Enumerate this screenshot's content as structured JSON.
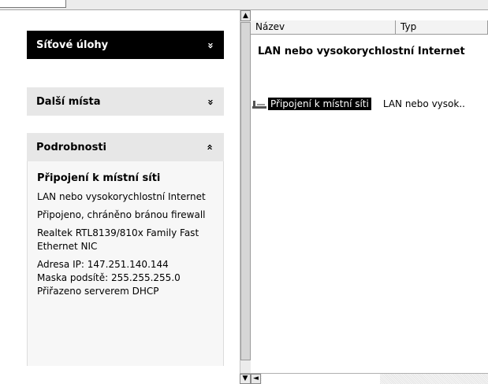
{
  "task_pane": {
    "network_tasks": {
      "label": "Síťové úlohy",
      "chevron": "»",
      "chevron_icon": "chevron-double-down-icon"
    },
    "other_places": {
      "label": "Další místa",
      "chevron": "»",
      "chevron_icon": "chevron-double-down-icon"
    },
    "details": {
      "label": "Podrobnosti",
      "chevron": "»",
      "chevron_icon": "chevron-double-up-icon",
      "title": "Připojení k místní síti",
      "type_line": "LAN nebo vysokorychlostní Internet",
      "status_line": "Připojeno, chráněno bránou firewall",
      "device_line": "Realtek RTL8139/810x Family Fast Ethernet NIC",
      "ip_line": "Adresa IP: 147.251.140.144",
      "mask_line": "Maska podsítě: 255.255.255.0",
      "dhcp_line": "Přiřazeno serverem DHCP"
    }
  },
  "list": {
    "columns": [
      {
        "label": "Název"
      },
      {
        "label": "Typ"
      }
    ],
    "group_header": "LAN nebo vysokorychlostní Internet",
    "items": [
      {
        "name": "Připojení k místní síti",
        "type": "LAN nebo vysok..",
        "icon": "network-connection-icon"
      }
    ]
  },
  "scrollbar": {
    "up": "▲",
    "down": "▼",
    "left": "◄"
  },
  "colors": {
    "selection": "#000000",
    "panel_dark": "#000000",
    "panel_light": "#e7e7e7",
    "details_bg": "#f7f7f7"
  }
}
